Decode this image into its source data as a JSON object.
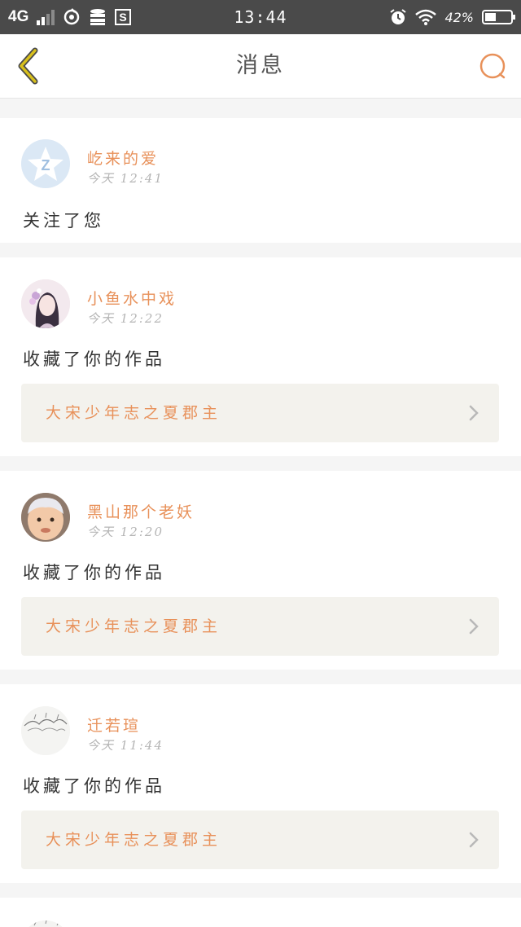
{
  "status_bar": {
    "network": "4G",
    "time": "13:44",
    "battery_percent": "42%",
    "battery_level": 0.42
  },
  "nav": {
    "title": "消息",
    "accent_color": "#e8915a",
    "back_color": "#c9a800"
  },
  "messages": [
    {
      "username": "屹来的爱",
      "time": "今天 12:41",
      "action": "关注了您"
    },
    {
      "username": "小鱼水中戏",
      "time": "今天 12:22",
      "action": "收藏了你的作品",
      "work_title": "大宋少年志之夏郡主"
    },
    {
      "username": "黑山那个老妖",
      "time": "今天 12:20",
      "action": "收藏了你的作品",
      "work_title": "大宋少年志之夏郡主"
    },
    {
      "username": "迁若瑄",
      "time": "今天 11:44",
      "action": "收藏了你的作品",
      "work_title": "大宋少年志之夏郡主"
    }
  ]
}
